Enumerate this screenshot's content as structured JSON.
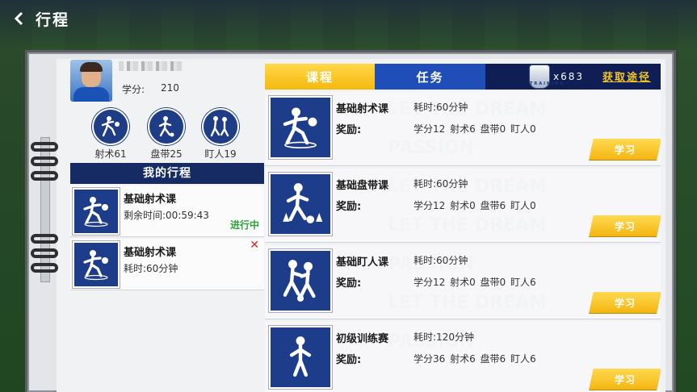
{
  "header": {
    "title": "行程"
  },
  "player": {
    "credit_label": "学分:",
    "credit_value": "210"
  },
  "stats": [
    {
      "label": "射术61",
      "icon": "shooting-player-icon"
    },
    {
      "label": "盘带25",
      "icon": "dribbling-player-icon"
    },
    {
      "label": "盯人19",
      "icon": "marking-players-icon"
    }
  ],
  "my_plan": {
    "header": "我的行程",
    "items": [
      {
        "title": "基础射术课",
        "sub": "剩余时间:00:59:43",
        "status": "进行中"
      },
      {
        "title": "基础射术课",
        "sub": "耗时:60分钟",
        "close": "✕"
      }
    ]
  },
  "tabs": {
    "course": "课程",
    "task": "任务",
    "badge_text": "TRAINING",
    "badge_count": "x683",
    "get_link": "获取途径"
  },
  "courses": [
    {
      "name": "基础射术课",
      "time": "耗时:60分钟",
      "reward_label": "奖励:",
      "reward": "学分12 射术6 盘带0 盯人0",
      "button": "学习"
    },
    {
      "name": "基础盘带课",
      "time": "耗时:60分钟",
      "reward_label": "奖励:",
      "reward": "学分12 射术0 盘带6 盯人0",
      "button": "学习"
    },
    {
      "name": "基础盯人课",
      "time": "耗时:60分钟",
      "reward_label": "奖励:",
      "reward": "学分12 射术0 盘带0 盯人6",
      "button": "学习"
    },
    {
      "name": "初级训练赛",
      "time": "耗时:120分钟",
      "reward_label": "奖励:",
      "reward": "学分36 射术6 盘带6 盯人6",
      "button": "学习"
    }
  ],
  "colors": {
    "navy": "#162a63",
    "tab_yellow": "#f5b90d",
    "tab_blue": "#1f4eb8",
    "status_green": "#2ea33a",
    "close_red": "#d0271e"
  }
}
